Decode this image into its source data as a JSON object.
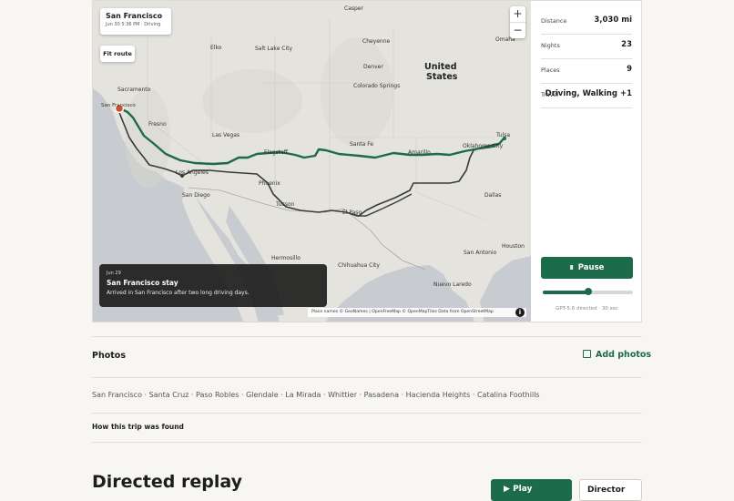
{
  "map": {
    "place_pill": {
      "title": "San Francisco",
      "subtitle": "Jun 30 5:36 PM · Driving"
    },
    "fit_route_label": "Fit route",
    "zoom_in": "+",
    "zoom_out": "−",
    "labels": {
      "casper": "Casper",
      "cheyenne": "Cheyenne",
      "omaha": "Omaha",
      "elko": "Elko",
      "slc": "Salt Lake City",
      "united": "United",
      "states": "States",
      "denver": "Denver",
      "sacramento": "Sacramento",
      "sanfrancisco": "San Francisco",
      "colorado": "Colorado Springs",
      "fresno": "Fresno",
      "lasvegas": "Las Vegas",
      "santafe": "Santa Fe",
      "flagstaff": "Flagstaff",
      "amarillo": "Amarillo",
      "tulsa": "Tulsa",
      "okc": "Oklahoma City",
      "losangeles": "Los Angeles",
      "phoenix": "Phoenix",
      "sandiego": "San Diego",
      "dallas": "Dallas",
      "tucson": "Tucson",
      "elpaso": "El Paso",
      "sanantonio": "San Antonio",
      "houston": "Houston",
      "hermosillo": "Hermosillo",
      "chihuahua": "Chihuahua City",
      "nuevolaredo": "Nuevo Laredo"
    },
    "stay_card": {
      "date": "Jun 29",
      "title": "San Francisco stay",
      "description": "Arrived in San Francisco after two long driving days."
    },
    "attribution": "Place names © GeoNames | OpenFreeMap © OpenMapTiles Data from OpenStreetMap",
    "info_icon": "i",
    "route_color": "#1c6b4a",
    "secondary_route_color": "#3a3a3a"
  },
  "stats": [
    {
      "label": "Distance",
      "value": "3,030 mi"
    },
    {
      "label": "Nights",
      "value": "23"
    },
    {
      "label": "Places",
      "value": "9"
    },
    {
      "label": "Travel",
      "value": "Driving, Walking +1"
    }
  ],
  "playback": {
    "pause_label": "Pause",
    "pause_icon": "II",
    "progress": 0.5,
    "meta": "GPT-5.6 directed · 30 sec"
  },
  "photos": {
    "title": "Photos",
    "add_label": "Add photos"
  },
  "stops_line": "San Francisco · Santa Cruz · Paso Robles · Glendale · La Mirada · Whittier · Pasadena · Hacienda Heights · Catalina Foothills",
  "found_title": "How this trip was found",
  "replay": {
    "title": "Directed replay",
    "play_label": "Play",
    "second_label": "Director"
  },
  "colors": {
    "accent": "#1c6b4a",
    "background": "#f7f6f2"
  }
}
